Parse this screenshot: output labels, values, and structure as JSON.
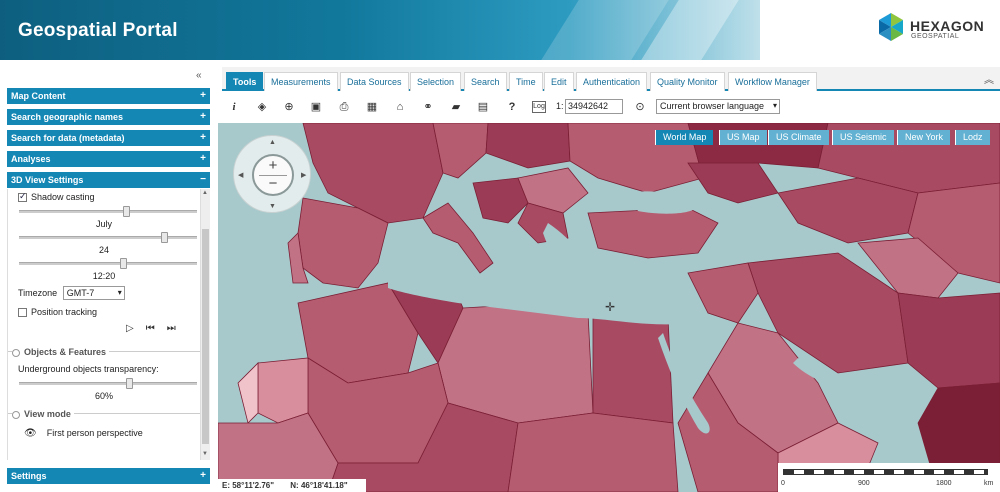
{
  "header": {
    "title": "Geospatial Portal",
    "logo_name": "HEXAGON",
    "logo_sub": "GEOSPATIAL"
  },
  "left_panel": {
    "sections": [
      {
        "label": "Map Content",
        "toggle": "+"
      },
      {
        "label": "Search geographic names",
        "toggle": "+"
      },
      {
        "label": "Search for data (metadata)",
        "toggle": "+"
      },
      {
        "label": "Analyses",
        "toggle": "+"
      },
      {
        "label": "3D View Settings",
        "toggle": "−"
      }
    ],
    "settings_footer": {
      "label": "Settings",
      "toggle": "+"
    },
    "view3d": {
      "shadow_casting": "Shadow casting",
      "month": "July",
      "day": "24",
      "time": "12:20",
      "timezone_label": "Timezone",
      "timezone_value": "GMT-7",
      "position_tracking": "Position tracking",
      "objects_title": "Objects & Features",
      "underground_label": "Underground objects transparency:",
      "transparency_value": "60%",
      "view_mode_title": "View mode",
      "view_mode_value": "First person perspective"
    }
  },
  "tabs": [
    {
      "label": "Tools",
      "active": true
    },
    {
      "label": "Measurements"
    },
    {
      "label": "Data Sources"
    },
    {
      "label": "Selection"
    },
    {
      "label": "Search"
    },
    {
      "label": "Time"
    },
    {
      "label": "Edit"
    },
    {
      "label": "Authentication"
    },
    {
      "label": "Quality Monitor"
    },
    {
      "label": "Workflow Manager"
    }
  ],
  "toolbar": {
    "scale_prefix": "1:",
    "scale_value": "34942642",
    "language": "Current browser language",
    "info_glyph": "i",
    "help_glyph": "?",
    "log_glyph": "Log"
  },
  "map": {
    "basemaps": [
      {
        "label": "World Map",
        "active": true
      },
      {
        "label": "US Map"
      },
      {
        "label": "US Climate"
      },
      {
        "label": "US Seismic"
      },
      {
        "label": "New York"
      },
      {
        "label": "Lodz"
      }
    ],
    "coord_e": "E: 58°11'2.76\"",
    "coord_n": "N: 46°18'41.18\"",
    "scale_ticks": [
      "0",
      "900",
      "1800",
      "km"
    ],
    "zoom_in": "+",
    "zoom_out": "−"
  },
  "colors": {
    "accent": "#1587b5",
    "water": "#a7c9cc",
    "land_dark": "#8c2a44",
    "land_mid": "#b65c70",
    "land_light": "#d88e9c"
  }
}
